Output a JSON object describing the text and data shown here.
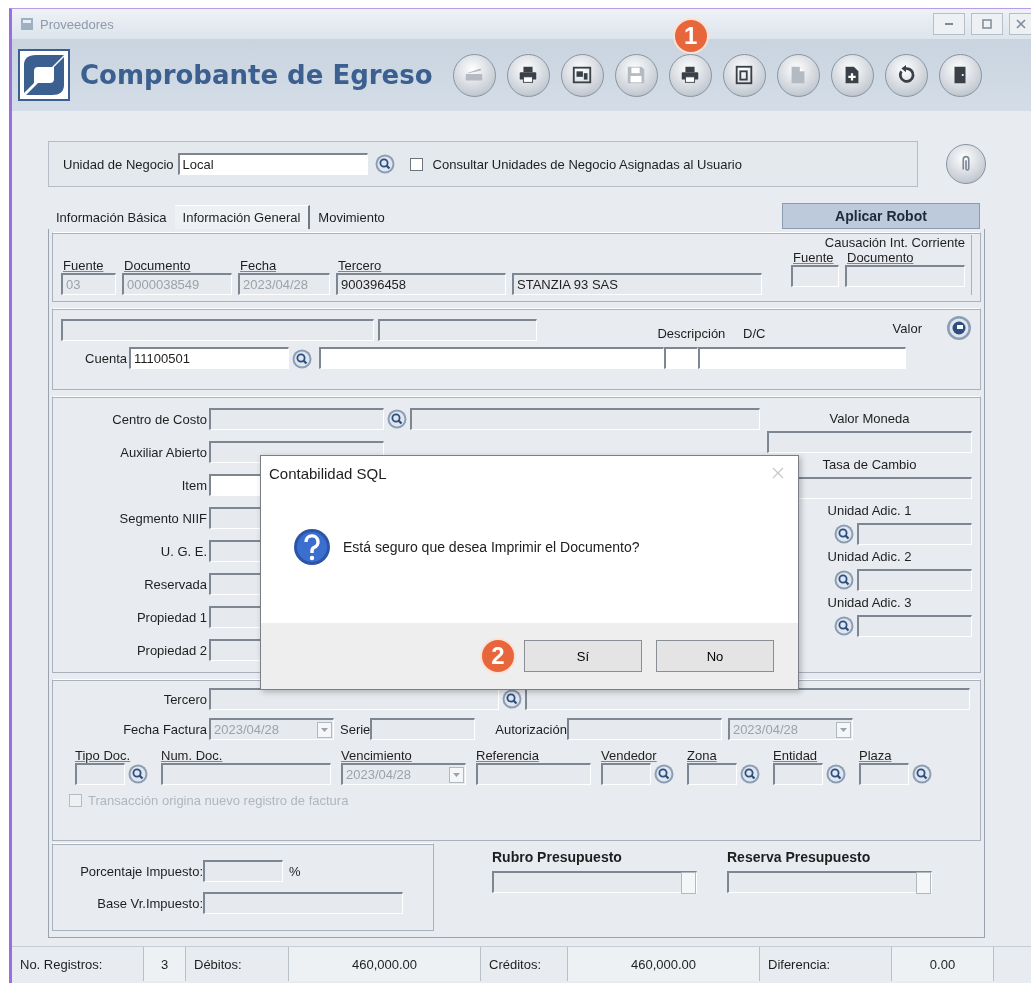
{
  "window": {
    "title": "Proveedores"
  },
  "header": {
    "title": "Comprobante de Egreso",
    "toolbar": [
      {
        "kind": "scanner",
        "disabled": true
      },
      {
        "kind": "printer",
        "disabled": false
      },
      {
        "kind": "preview",
        "disabled": false
      },
      {
        "kind": "save",
        "disabled": true
      },
      {
        "kind": "printer",
        "disabled": false,
        "callout": "1"
      },
      {
        "kind": "window",
        "disabled": false
      },
      {
        "kind": "document",
        "disabled": true
      },
      {
        "kind": "document-add",
        "disabled": false
      },
      {
        "kind": "undo",
        "disabled": false
      },
      {
        "kind": "exit",
        "disabled": false
      }
    ]
  },
  "business_unit": {
    "label": "Unidad de Negocio",
    "value": "Local",
    "option": {
      "label": "Consultar Unidades de Negocio Asignadas al Usuario",
      "checked": false
    }
  },
  "tabs": [
    {
      "label": "Información Básica",
      "selected": false
    },
    {
      "label": "Información General",
      "selected": true
    },
    {
      "label": "Movimiento",
      "selected": false
    }
  ],
  "robot_button": "Aplicar Robot",
  "document": {
    "fields": [
      {
        "label": "Fuente",
        "value": "03",
        "disabled": true
      },
      {
        "label": "Documento",
        "value": "0000038549",
        "disabled": true
      },
      {
        "label": "Fecha",
        "value": "2023/04/28",
        "disabled": true
      },
      {
        "label": "Tercero",
        "value": "900396458",
        "disabled": false
      }
    ],
    "third_party_name": "STANZIA 93 SAS",
    "causation": {
      "title": "Causación Int. Corriente",
      "fields": [
        {
          "label": "Fuente"
        },
        {
          "label": "Documento"
        }
      ]
    }
  },
  "entry": {
    "account_label": "Cuenta",
    "account": "11100501",
    "description_label": "Descripción",
    "dc_label": "D/C",
    "value_label": "Valor"
  },
  "details": {
    "fields": [
      {
        "label": "Centro de Costo",
        "kind": "lookup",
        "disabled": true
      },
      {
        "label": "Auxiliar Abierto",
        "kind": "plain",
        "disabled": true
      },
      {
        "label": "Item",
        "kind": "plain",
        "disabled": false
      },
      {
        "label": "Segmento NIIF",
        "kind": "plain",
        "disabled": true
      },
      {
        "label": "U. G. E.",
        "kind": "plain",
        "disabled": true
      },
      {
        "label": "Reservada",
        "kind": "plain",
        "disabled": true
      },
      {
        "label": "Propiedad 1",
        "kind": "plain",
        "disabled": true
      },
      {
        "label": "Propiedad 2",
        "kind": "plain",
        "disabled": true
      }
    ],
    "extra": [
      {
        "label": "Valor Moneda",
        "kind": "plain"
      },
      {
        "label": "Tasa de Cambio",
        "kind": "plain"
      },
      {
        "label": "Unidad Adic. 1",
        "kind": "lookup"
      },
      {
        "label": "Unidad Adic. 2",
        "kind": "lookup"
      },
      {
        "label": "Unidad Adic. 3",
        "kind": "lookup"
      }
    ]
  },
  "invoice": {
    "third_party_label": "Tercero",
    "invoice_date_label": "Fecha Factura",
    "invoice_date": "2023/04/28",
    "series_label": "Serie",
    "authorization_label": "Autorización",
    "authorization_date": "2023/04/28",
    "columns": [
      {
        "label": "Tipo Doc.",
        "kind": "lookup"
      },
      {
        "label": "Num. Doc.",
        "kind": "wide"
      },
      {
        "label": "Vencimiento",
        "kind": "date",
        "value": "2023/04/28"
      },
      {
        "label": "Referencia",
        "kind": "text"
      },
      {
        "label": "Vendedor",
        "kind": "lookup"
      },
      {
        "label": "Zona",
        "kind": "lookup"
      },
      {
        "label": "Entidad",
        "kind": "lookup"
      },
      {
        "label": "Plaza",
        "kind": "lookup"
      }
    ],
    "new_invoice": {
      "label": "Transacción origina nuevo registro de factura",
      "checked": false,
      "disabled": true
    }
  },
  "tax": {
    "percent_label": "Porcentaje Impuesto:",
    "percent_unit": "%",
    "base_label": "Base Vr.Impuesto:"
  },
  "budget": [
    {
      "title": "Rubro Presupuesto"
    },
    {
      "title": "Reserva Presupuesto"
    }
  ],
  "status_bar": [
    {
      "label": "No. Registros:",
      "value": "3"
    },
    {
      "label": "Débitos:",
      "value": "460,000.00"
    },
    {
      "label": "Créditos:",
      "value": "460,000.00"
    },
    {
      "label": "Diferencia:",
      "value": "0.00"
    }
  ],
  "dialog": {
    "title": "Contabilidad SQL",
    "message": "Está seguro que desea Imprimir el Documento?",
    "buttons": [
      {
        "label": "Sí",
        "callout": "2"
      },
      {
        "label": "No"
      }
    ]
  }
}
